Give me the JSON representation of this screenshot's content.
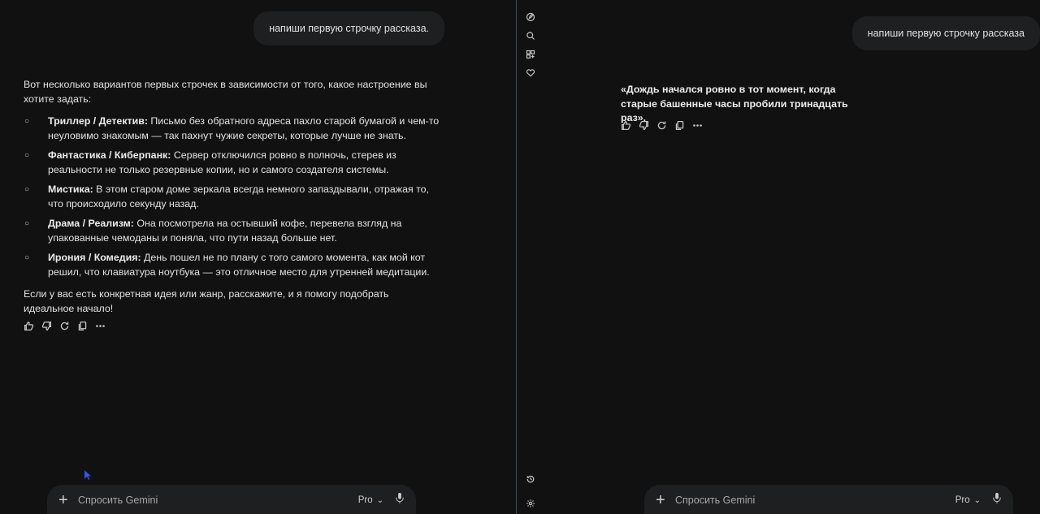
{
  "left": {
    "user_message": "напиши первую строчку рассказа.",
    "intro": "Вот несколько вариантов первых строчек в зависимости от того, какое настроение вы хотите задать:",
    "options": [
      {
        "genre": "Триллер / Детектив:",
        "text": " Письмо без обратного адреса пахло старой бумагой и чем-то неуловимо знакомым — так пахнут чужие секреты, которые лучше не знать."
      },
      {
        "genre": "Фантастика / Киберпанк:",
        "text": " Сервер отключился ровно в полночь, стерев из реальности не только резервные копии, но и самого создателя системы."
      },
      {
        "genre": "Мистика:",
        "text": " В этом старом доме зеркала всегда немного запаздывали, отражая то, что происходило секунду назад."
      },
      {
        "genre": "Драма / Реализм:",
        "text": " Она посмотрела на остывший кофе, перевела взгляд на упакованные чемоданы и поняла, что пути назад больше нет."
      },
      {
        "genre": "Ирония / Комедия:",
        "text": " День пошел не по плану с того самого момента, как мой кот решил, что клавиатура ноутбука — это отличное место для утренней медитации."
      }
    ],
    "outro": "Если у вас есть конкретная идея или жанр, расскажите, и я помогу подобрать идеальное начало!",
    "bullet": "○",
    "composer": {
      "placeholder": "Спросить Gemini",
      "mode": "Pro",
      "plus": "+",
      "chevron": "⌄"
    }
  },
  "right": {
    "user_message": "напиши первую строчку рассказа",
    "answer": "«Дождь начался ровно в тот момент, когда старые башенные часы пробили тринадцать раз».",
    "composer": {
      "placeholder": "Спросить Gemini",
      "mode": "Pro",
      "plus": "+",
      "chevron": "⌄"
    }
  },
  "icons": {
    "actions": [
      "thumbs-up-icon",
      "thumbs-down-icon",
      "regenerate-icon",
      "copy-icon",
      "more-icon"
    ],
    "rail_top": [
      "new-chat-icon",
      "search-icon",
      "gems-icon",
      "heart-icon"
    ],
    "rail_bottom": [
      "history-icon",
      "settings-icon"
    ],
    "mic": "mic-icon"
  },
  "colors": {
    "background": "#111112",
    "bubble": "#1e1f20",
    "divider": "#3b4c57",
    "text": "#e3e3e3"
  }
}
